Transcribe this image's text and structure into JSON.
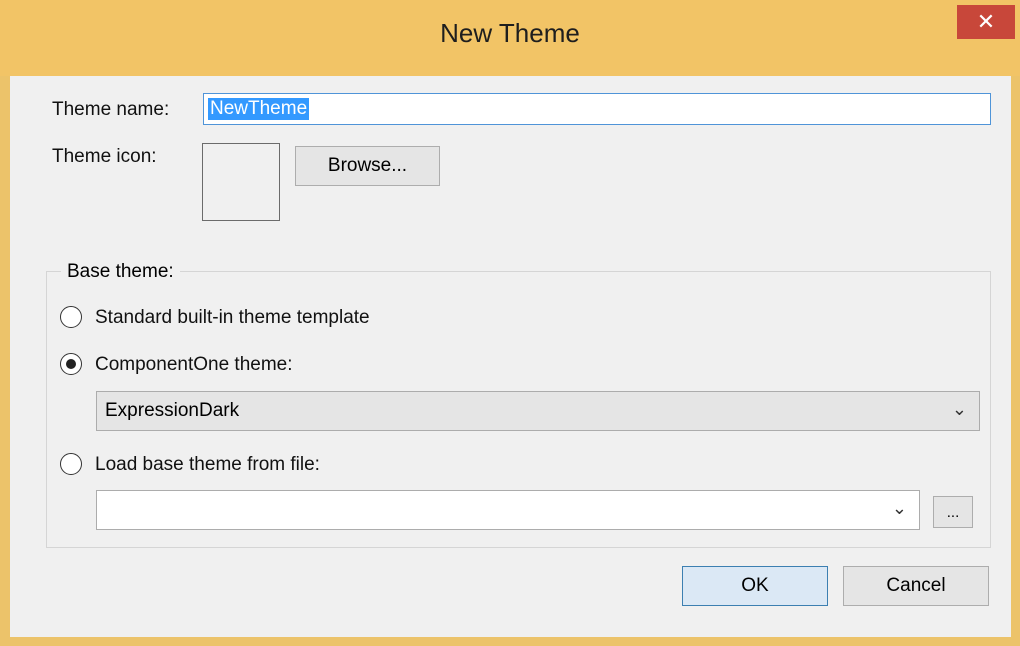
{
  "window": {
    "title": "New Theme",
    "close_glyph": "✕"
  },
  "theme_name": {
    "label": "Theme name:",
    "value": "NewTheme"
  },
  "theme_icon": {
    "label": "Theme icon:",
    "browse_label": "Browse..."
  },
  "base_theme": {
    "legend": "Base theme:",
    "options": [
      {
        "label": "Standard built-in theme template",
        "selected": false
      },
      {
        "label": "ComponentOne theme:",
        "selected": true
      },
      {
        "label": "Load base theme from file:",
        "selected": false
      }
    ],
    "componentone_theme_value": "ExpressionDark",
    "file_value": "",
    "file_browse_label": "..."
  },
  "actions": {
    "ok_label": "OK",
    "cancel_label": "Cancel"
  },
  "colors": {
    "titlebar": "#f2c466",
    "close": "#c8473a",
    "selection": "#3399ff"
  }
}
